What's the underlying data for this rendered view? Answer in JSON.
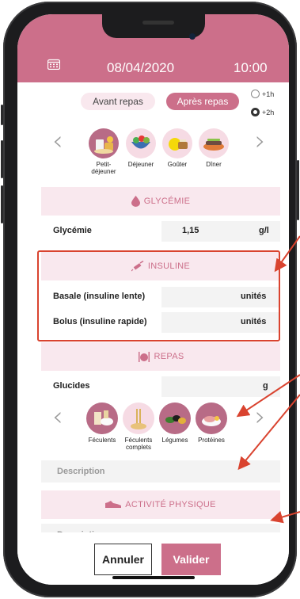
{
  "header": {
    "date": "08/04/2020",
    "time": "10:00",
    "icon": "calendar-icon"
  },
  "meal_toggle": {
    "before_label": "Avant repas",
    "after_label": "Après repas",
    "selected": "after"
  },
  "time_offset": {
    "options": [
      "+1h",
      "+2h"
    ],
    "selected": "+2h"
  },
  "meals": [
    {
      "label": "Petit-déjeuner",
      "label_lines": [
        "Petit-",
        "déjeuner"
      ],
      "active": true
    },
    {
      "label": "Déjeuner",
      "label_lines": [
        "Déjeuner"
      ],
      "active": false
    },
    {
      "label": "Goûter",
      "label_lines": [
        "Goûter"
      ],
      "active": false
    },
    {
      "label": "Dîner",
      "label_lines": [
        "Dîner"
      ],
      "active": false
    }
  ],
  "glycemie": {
    "title": "GLYCÉMIE",
    "icon": "drop-icon",
    "row_label": "Glycémie",
    "value": "1,15",
    "unit": "g/l"
  },
  "insuline": {
    "title": "INSULINE",
    "icon": "syringe-icon",
    "rows": [
      {
        "label": "Basale (insuline lente)",
        "unit": "unités"
      },
      {
        "label": "Bolus (insuline rapide)",
        "unit": "unités"
      }
    ]
  },
  "repas": {
    "title": "REPAS",
    "icon": "utensils-icon",
    "glucides_label": "Glucides",
    "glucides_unit": "g",
    "foods": [
      {
        "label_lines": [
          "Féculents"
        ]
      },
      {
        "label_lines": [
          "Féculents",
          "complets"
        ]
      },
      {
        "label_lines": [
          "Légumes"
        ]
      },
      {
        "label_lines": [
          "Protéines"
        ]
      }
    ],
    "description_placeholder": "Description"
  },
  "activite": {
    "title": "ACTIVITÉ PHYSIQUE",
    "icon": "shoe-icon",
    "description_placeholder": "Description"
  },
  "footer": {
    "cancel_label": "Annuler",
    "ok_label": "Valider"
  },
  "colors": {
    "accent": "#cc6f8a",
    "accent_light": "#f9e8ee",
    "annotation": "#d9432f"
  }
}
